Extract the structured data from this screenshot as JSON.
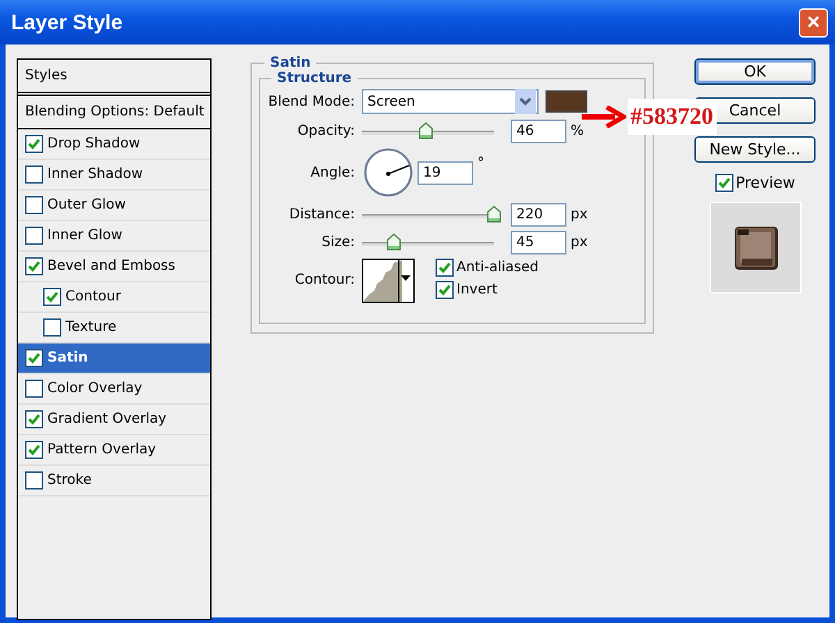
{
  "window": {
    "title": "Layer Style",
    "close": "×"
  },
  "sidebar": {
    "items": [
      {
        "kind": "header",
        "label": "Styles",
        "selected": false
      },
      {
        "kind": "option",
        "label": "Blending Options: Default",
        "selected": false
      },
      {
        "kind": "effect",
        "label": "Drop Shadow",
        "checked": true,
        "selected": false
      },
      {
        "kind": "effect",
        "label": "Inner Shadow",
        "checked": false,
        "selected": false
      },
      {
        "kind": "effect",
        "label": "Outer Glow",
        "checked": false,
        "selected": false
      },
      {
        "kind": "effect",
        "label": "Inner Glow",
        "checked": false,
        "selected": false
      },
      {
        "kind": "effect",
        "label": "Bevel and Emboss",
        "checked": true,
        "selected": false,
        "children": [
          {
            "label": "Contour",
            "checked": true,
            "selected": false
          },
          {
            "label": "Texture",
            "checked": false,
            "selected": false
          }
        ]
      },
      {
        "kind": "effect",
        "label": "Satin",
        "checked": true,
        "selected": true
      },
      {
        "kind": "effect",
        "label": "Color Overlay",
        "checked": false,
        "selected": false
      },
      {
        "kind": "effect",
        "label": "Gradient Overlay",
        "checked": true,
        "selected": false
      },
      {
        "kind": "effect",
        "label": "Pattern Overlay",
        "checked": true,
        "selected": false
      },
      {
        "kind": "effect",
        "label": "Stroke",
        "checked": false,
        "selected": false
      }
    ]
  },
  "satin": {
    "title": "Satin",
    "structure": {
      "title": "Structure",
      "blend_mode": {
        "label": "Blend Mode:",
        "value": "Screen",
        "color": "#583720"
      },
      "opacity": {
        "label": "Opacity:",
        "level": 0.46,
        "value": "46",
        "unit": "%"
      },
      "angle": {
        "label": "Angle:",
        "value": "19",
        "unit": "°"
      },
      "distance": {
        "label": "Distance:",
        "level": 0.95,
        "value": "220",
        "unit": "px"
      },
      "size": {
        "label": "Size:",
        "level": 0.23,
        "value": "45",
        "unit": "px"
      },
      "contour": {
        "label": "Contour:"
      },
      "options": [
        {
          "label": "Anti-aliased",
          "checked": true
        },
        {
          "label": "Invert",
          "checked": true
        }
      ]
    }
  },
  "annotation": {
    "text": "#583720"
  },
  "buttons": [
    {
      "label": "OK",
      "default": true
    },
    {
      "label": "Cancel",
      "default": false
    },
    {
      "label": "New Style...",
      "default": false
    }
  ],
  "preview": {
    "label": "Preview",
    "checked": true
  }
}
